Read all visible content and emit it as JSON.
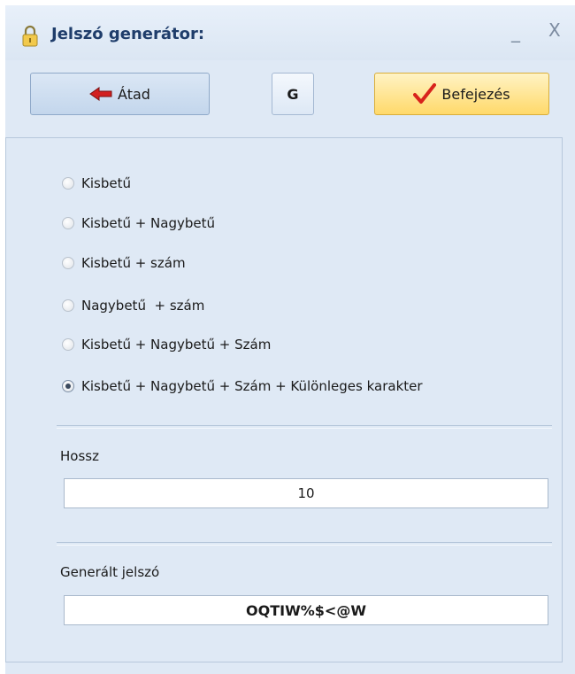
{
  "window": {
    "title": "Jelszó generátor:",
    "minimize_glyph": "_",
    "close_glyph": "X",
    "icon": "lock-icon"
  },
  "toolbar": {
    "transfer_label": "Átad",
    "transfer_icon": "arrow-left-icon",
    "generate_label": "G",
    "finish_label": "Befejezés",
    "finish_icon": "checkmark-icon"
  },
  "options": {
    "items": [
      {
        "label": "Kisbetű",
        "checked": false
      },
      {
        "label": "Kisbetű + Nagybetű",
        "checked": false
      },
      {
        "label": "Kisbetű + szám",
        "checked": false
      },
      {
        "label": "Nagybetű  + szám",
        "checked": false
      },
      {
        "label": "Kisbetű + Nagybetű + Szám",
        "checked": false
      },
      {
        "label": "Kisbetű + Nagybetű + Szám + Különleges karakter",
        "checked": true
      }
    ]
  },
  "length": {
    "label": "Hossz",
    "value": "10"
  },
  "generated": {
    "label": "Generált jelszó",
    "value": "OQTIW%$<@W"
  },
  "colors": {
    "accent_arrow": "#d21f1f",
    "check": "#d8231c",
    "panel_bg": "#dfe9f5",
    "finish_button": "#ffd96a"
  }
}
